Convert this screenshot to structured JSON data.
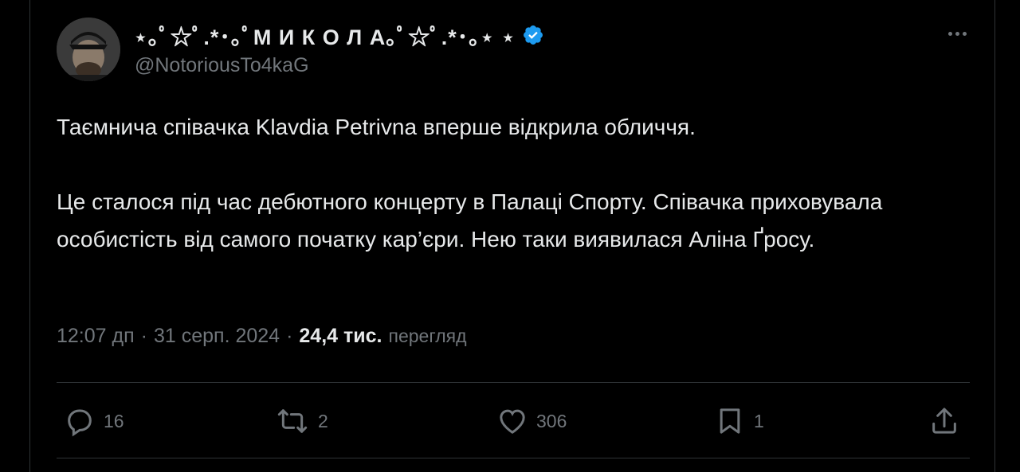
{
  "author": {
    "display_name": "⋆｡ﾟ☆ﾟ.*･｡ﾟМ И К О Л А｡ﾟ☆ﾟ.*･｡⋆ ⋆",
    "handle": "@NotoriousTo4kaG",
    "verified": true
  },
  "body": {
    "paragraph_1": "Таємнича співачка Klavdia Petrivna вперше відкрила обличчя.",
    "paragraph_2": "Це сталося під час дебютного концерту в Палаці Спорту. Співачка приховувала особистість від самого початку кар’єри. Нею таки виявилася Аліна Ґросу."
  },
  "meta": {
    "time": "12:07 дп",
    "separator": "·",
    "date": "31 серп. 2024",
    "views_count": "24,4 тис.",
    "views_label": "перегляд"
  },
  "actions": {
    "replies": "16",
    "reposts": "2",
    "likes": "306",
    "bookmarks": "1"
  },
  "colors": {
    "background": "#000000",
    "text_primary": "#e7e9ea",
    "text_secondary": "#71767b",
    "verified_badge": "#1d9bf0",
    "divider": "#2f3336"
  },
  "icons": {
    "more": "more-horizontal-icon",
    "verified": "verified-badge-icon",
    "reply": "reply-icon",
    "repost": "repost-icon",
    "like": "heart-icon",
    "bookmark": "bookmark-icon",
    "share": "share-icon"
  }
}
